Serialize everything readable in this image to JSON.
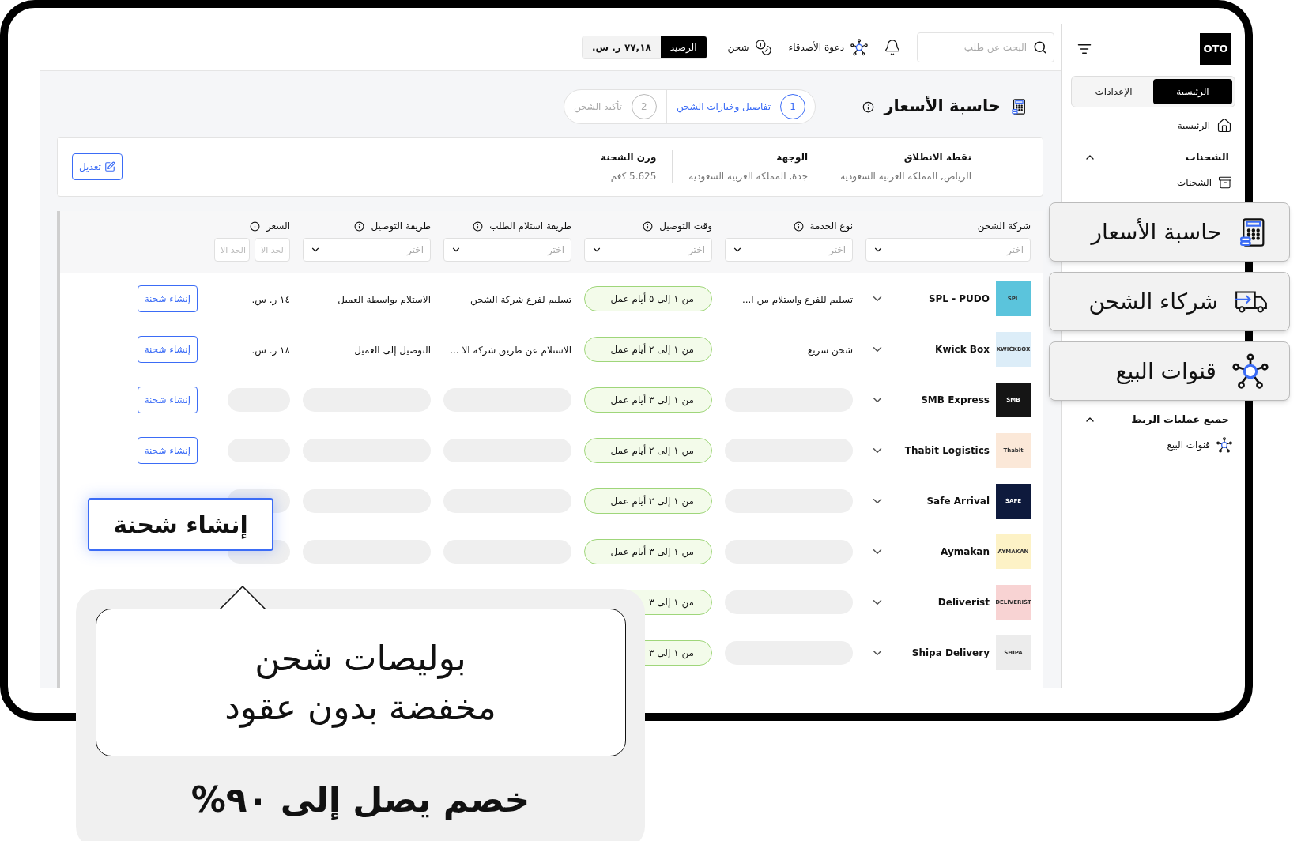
{
  "sidebar": {
    "logo": "OTO",
    "tabs": [
      {
        "label": "الرئيسية",
        "selected": true
      },
      {
        "label": "الإعدادات",
        "selected": false
      }
    ],
    "items": [
      {
        "kind": "link",
        "label": "الرئيسية"
      },
      {
        "kind": "section",
        "label": "الشحنات",
        "expanded": true
      },
      {
        "kind": "link",
        "label": "الشحنات"
      },
      {
        "kind": "section",
        "label": "جميع عمليات الربط",
        "expanded": true
      },
      {
        "kind": "link",
        "label": "قنوات البيع"
      }
    ]
  },
  "topbar": {
    "search_placeholder": "البحث عن طلب",
    "invite": "دعوة الأصدقاء",
    "recharge": "شحن",
    "balance_label": "الرصيد",
    "balance": "٧٧,١٨ ر. س."
  },
  "header": {
    "title": "حاسبة الأسعار",
    "steps": [
      {
        "number": "1",
        "label": "تفاصيل وخيارات الشحن",
        "selected": true
      },
      {
        "number": "2",
        "label": "تأكيد الشحن",
        "selected": false
      }
    ]
  },
  "summary": {
    "fields": [
      {
        "label": "نقطة الانطلاق",
        "value": "الرياض, المملكة العربية السعودية"
      },
      {
        "label": "الوجهة",
        "value": "جدة, المملكة العربية السعودية"
      },
      {
        "label": "وزن الشحنة",
        "value": "5.625 كغم"
      }
    ],
    "edit": "تعديل"
  },
  "table": {
    "columns": [
      {
        "label": "شركة الشحن",
        "info": false,
        "kind": "select",
        "placeholders": [
          "اختر"
        ]
      },
      {
        "label": "نوع الخدمة",
        "info": true,
        "kind": "select",
        "placeholders": [
          "اختر"
        ]
      },
      {
        "label": "وقت التوصيل",
        "info": true,
        "kind": "select",
        "placeholders": [
          "اختر"
        ]
      },
      {
        "label": "طريقة استلام الطلب",
        "info": true,
        "kind": "select",
        "placeholders": [
          "اختر"
        ]
      },
      {
        "label": "طريقة التوصيل",
        "info": true,
        "kind": "select",
        "placeholders": [
          "اختر"
        ]
      },
      {
        "label": "السعر",
        "info": true,
        "kind": "range",
        "placeholders": [
          "الحد الا",
          "الحد الا"
        ]
      }
    ],
    "rows": [
      {
        "carrier": "SPL - PUDO",
        "logo": {
          "text": "SPL",
          "color": "#5bc4dc"
        },
        "loading": false,
        "service": "تسليم للفرع واستلام من ا...",
        "time": "من ١ إلى ٥ أيام عمل",
        "pickup": "تسليم لفرع شركة الشحن",
        "delivery": "الاستلام بواسطة العميل",
        "price": "١٤ ر. س.",
        "action": "إنشاء شحنة"
      },
      {
        "carrier": "Kwick Box",
        "logo": {
          "text": "KWICKBOX",
          "color": "#dcedf8"
        },
        "loading": false,
        "service": "شحن سريع",
        "time": "من ١ إلى ٢ أيام عمل",
        "pickup": "الاستلام عن طريق شركة الا ...",
        "delivery": "التوصيل إلى العميل",
        "price": "١٨ ر. س.",
        "action": "إنشاء شحنة"
      },
      {
        "carrier": "SMB Express",
        "logo": {
          "text": "SMB",
          "color": "#151515"
        },
        "loading": true,
        "time": "من ١ إلى ٣ أيام عمل",
        "action": "إنشاء شحنة"
      },
      {
        "carrier": "Thabit Logistics",
        "logo": {
          "text": "Thabit",
          "color": "#fbe8d8"
        },
        "loading": true,
        "time": "من ١ إلى ٢ أيام عمل",
        "action": "إنشاء شحنة"
      },
      {
        "carrier": "Safe Arrival",
        "logo": {
          "text": "SAFE",
          "color": "#0e1a3d"
        },
        "loading": true,
        "time": "من ١ إلى ٢ أيام عمل"
      },
      {
        "carrier": "Aymakan",
        "logo": {
          "text": "AYMAKAN",
          "color": "#fdf2c6"
        },
        "loading": true,
        "time": "من ١ إلى ٣ أيام عمل"
      },
      {
        "carrier": "Deliverist",
        "logo": {
          "text": "DELIVERIST",
          "color": "#f8d3d3"
        },
        "loading": true,
        "time": "من ١ إلى ٣"
      },
      {
        "carrier": "Shipa Delivery",
        "logo": {
          "text": "SHIPA",
          "color": "#ececec"
        },
        "loading": true,
        "time": "من ١ إلى ٣"
      }
    ]
  },
  "feature_cards": [
    {
      "label": "حاسبة الأسعار"
    },
    {
      "label": "شركاء الشحن"
    },
    {
      "label": "قنوات البيع"
    }
  ],
  "floating_button": "إنشاء شحنة",
  "promo": {
    "bubble_lines": [
      "بوليصات شحن",
      "مخفضة بدون عقود"
    ],
    "tagline": "خصم يصل إلى ٩٠%"
  }
}
